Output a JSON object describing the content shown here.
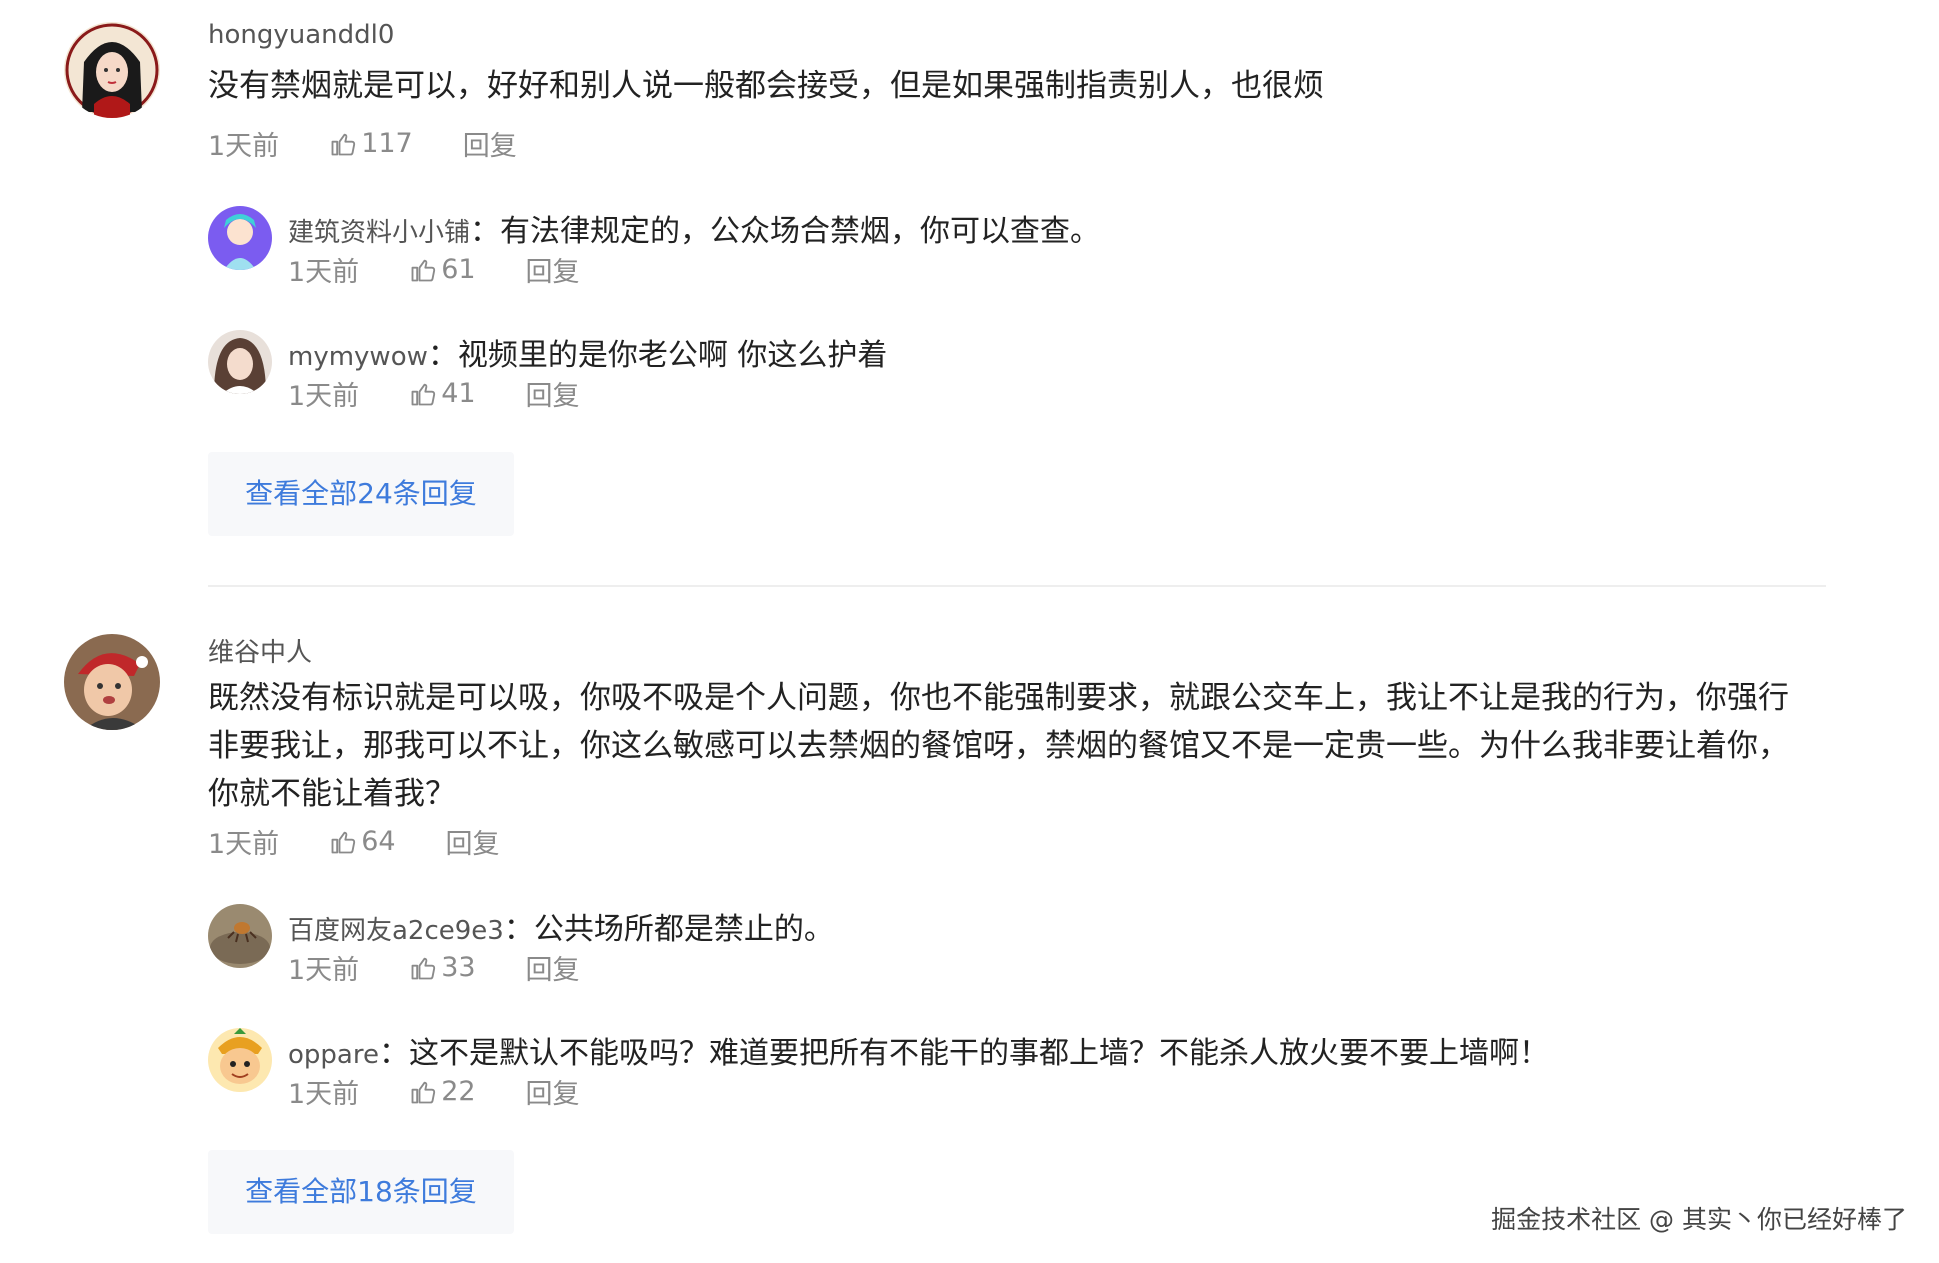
{
  "comments": [
    {
      "username": "hongyuanddl0",
      "content": "没有禁烟就是可以，好好和别人说一般都会接受，但是如果强制指责别人，也很烦",
      "time": "1天前",
      "likes": "117",
      "reply_label": "回复",
      "replies": [
        {
          "username": "建筑资料小小铺",
          "separator": "：",
          "content": "有法律规定的，公众场合禁烟，你可以查查。",
          "time": "1天前",
          "likes": "61",
          "reply_label": "回复"
        },
        {
          "username": "mymywow",
          "separator": "：",
          "content": "视频里的是你老公啊 你这么护着",
          "time": "1天前",
          "likes": "41",
          "reply_label": "回复"
        }
      ],
      "view_all_label": "查看全部24条回复"
    },
    {
      "username": "维谷中人",
      "content": "既然没有标识就是可以吸，你吸不吸是个人问题，你也不能强制要求，就跟公交车上，我让不让是我的行为，你强行非要我让，那我可以不让，你这么敏感可以去禁烟的餐馆呀，禁烟的餐馆又不是一定贵一些。为什么我非要让着你，你就不能让着我？",
      "time": "1天前",
      "likes": "64",
      "reply_label": "回复",
      "replies": [
        {
          "username": "百度网友a2ce9e3",
          "separator": "：",
          "content": "公共场所都是禁止的。",
          "time": "1天前",
          "likes": "33",
          "reply_label": "回复"
        },
        {
          "username": "oppare",
          "separator": "：",
          "content": "这不是默认不能吸吗？难道要把所有不能干的事都上墙？不能杀人放火要不要上墙啊！",
          "time": "1天前",
          "likes": "22",
          "reply_label": "回复"
        }
      ],
      "view_all_label": "查看全部18条回复"
    }
  ],
  "watermark": "掘金技术社区 @ 其实丶你已经好棒了",
  "colors": {
    "link": "#3e7bdc",
    "meta": "#8a8a8a",
    "text": "#222222",
    "button_bg": "#f7f8fa"
  }
}
